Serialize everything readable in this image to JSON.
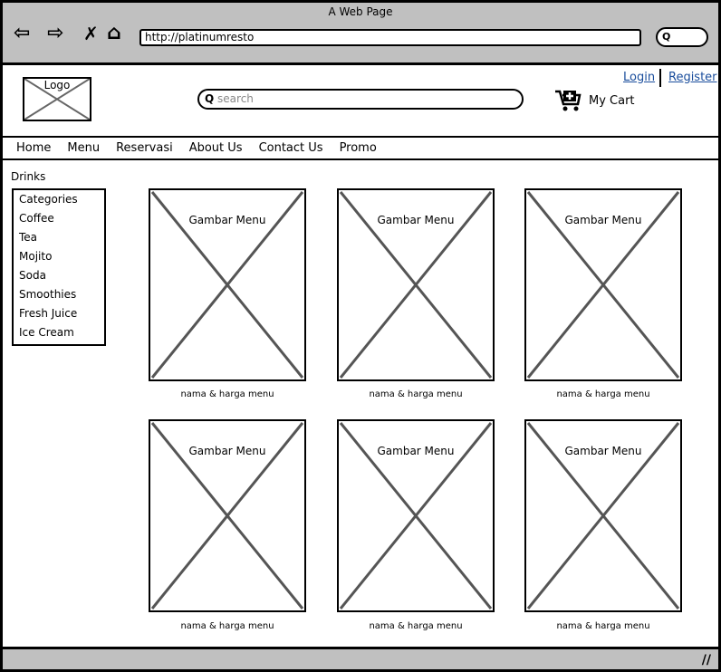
{
  "browser": {
    "title": "A Web Page",
    "url": "http://platinumresto",
    "icons": [
      "back-arrow-icon",
      "forward-arrow-icon",
      "close-icon",
      "home-icon",
      "search-icon"
    ]
  },
  "header": {
    "logo": "Logo",
    "search_placeholder": "search",
    "cart": "My Cart",
    "login": "Login",
    "register": "Register"
  },
  "nav": [
    "Home",
    "Menu",
    "Reservasi",
    "About Us",
    "Contact Us",
    "Promo"
  ],
  "sidebar": {
    "title": "Drinks",
    "items": [
      "Categories",
      "Coffee",
      "Tea",
      "Mojito",
      "Soda",
      "Smoothies",
      "Fresh Juice",
      "Ice Cream"
    ]
  },
  "products": [
    {
      "image": "Gambar Menu",
      "caption": "nama & harga menu"
    },
    {
      "image": "Gambar Menu",
      "caption": "nama & harga menu"
    },
    {
      "image": "Gambar Menu",
      "caption": "nama & harga menu"
    },
    {
      "image": "Gambar Menu",
      "caption": "nama & harga menu"
    },
    {
      "image": "Gambar Menu",
      "caption": "nama & harga menu"
    },
    {
      "image": "Gambar Menu",
      "caption": "nama & harga menu"
    }
  ],
  "colors": {
    "chrome": "#c0c0c0",
    "link": "#1a4d9c",
    "placeholder_x": "#555555"
  }
}
